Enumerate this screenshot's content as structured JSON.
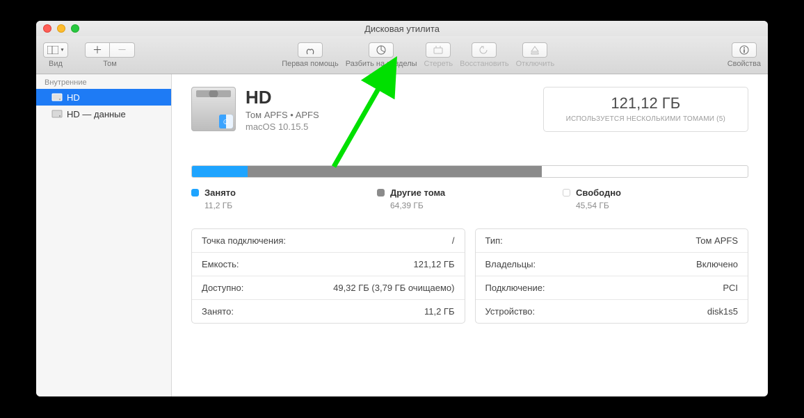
{
  "window": {
    "title": "Дисковая утилита"
  },
  "toolbar": {
    "view_label": "Вид",
    "volume_label": "Том",
    "first_aid_label": "Первая помощь",
    "partition_label": "Разбить на разделы",
    "erase_label": "Стереть",
    "restore_label": "Восстановить",
    "unmount_label": "Отключить",
    "info_label": "Свойства"
  },
  "sidebar": {
    "header": "Внутренние",
    "items": [
      {
        "label": "HD",
        "selected": true
      },
      {
        "label": "HD — данные",
        "selected": false
      }
    ]
  },
  "disk": {
    "name": "HD",
    "subtitle": "Том APFS • APFS",
    "os": "macOS 10.15.5"
  },
  "capacity": {
    "value": "121,12 ГБ",
    "note": "ИСПОЛЬЗУЕТСЯ НЕСКОЛЬКИМИ ТОМАМИ (5)"
  },
  "usage": {
    "used_pct": 10,
    "other_pct": 53,
    "legend": {
      "used": {
        "label": "Занято",
        "value": "11,2 ГБ"
      },
      "other": {
        "label": "Другие тома",
        "value": "64,39 ГБ"
      },
      "free": {
        "label": "Свободно",
        "value": "45,54 ГБ"
      }
    }
  },
  "details_left": [
    {
      "k": "Точка подключения:",
      "v": "/"
    },
    {
      "k": "Емкость:",
      "v": "121,12 ГБ"
    },
    {
      "k": "Доступно:",
      "v": "49,32 ГБ (3,79 ГБ очищаемо)"
    },
    {
      "k": "Занято:",
      "v": "11,2 ГБ"
    }
  ],
  "details_right": [
    {
      "k": "Тип:",
      "v": "Том APFS"
    },
    {
      "k": "Владельцы:",
      "v": "Включено"
    },
    {
      "k": "Подключение:",
      "v": "PCI"
    },
    {
      "k": "Устройство:",
      "v": "disk1s5"
    }
  ],
  "annotation": {
    "arrow_color": "#00e000"
  }
}
